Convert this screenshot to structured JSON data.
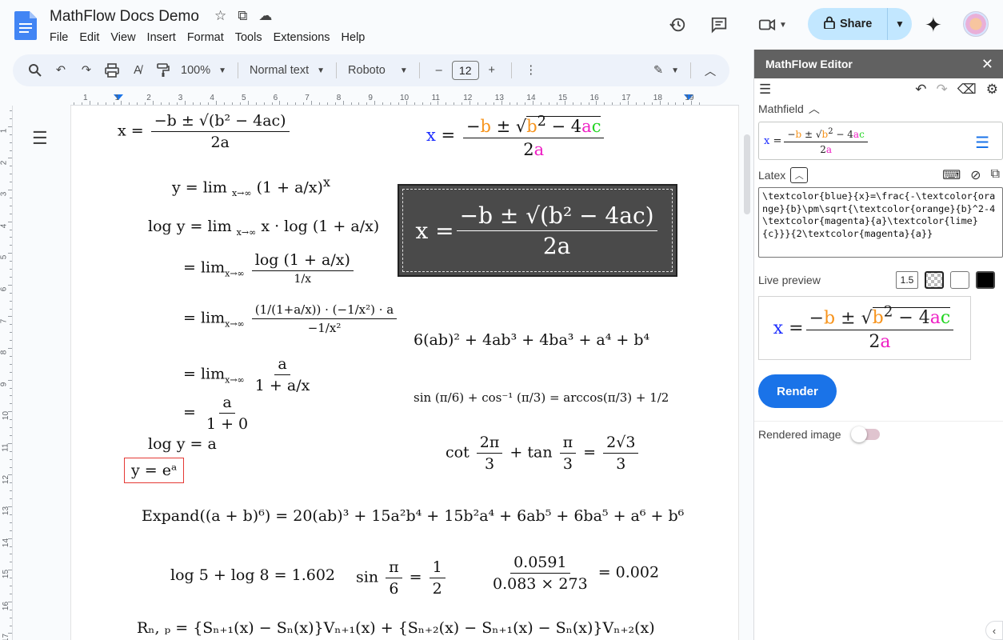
{
  "doc": {
    "title": "MathFlow Docs Demo",
    "menu": [
      "File",
      "Edit",
      "View",
      "Insert",
      "Format",
      "Tools",
      "Extensions",
      "Help"
    ]
  },
  "top_right": {
    "share_label": "Share",
    "icons": [
      "history-icon",
      "comment-icon",
      "meet-icon",
      "gemini-icon",
      "avatar"
    ]
  },
  "toolbar": {
    "zoom": "100%",
    "style": "Normal text",
    "font": "Roboto",
    "font_size": "12",
    "minus": "–",
    "plus": "+"
  },
  "ruler": {
    "numbers": [
      "1",
      "1",
      "2",
      "3",
      "4",
      "5",
      "6",
      "7",
      "8",
      "9",
      "10",
      "11",
      "12",
      "13",
      "14",
      "15",
      "16",
      "17",
      "18",
      "19"
    ],
    "vnumbers": [
      "1",
      "2",
      "3",
      "4",
      "5",
      "6",
      "7",
      "8",
      "9",
      "10",
      "11",
      "12",
      "13",
      "14",
      "15",
      "16",
      "17"
    ]
  },
  "document": {
    "formulas": {
      "quad_a_lhs": "x =",
      "quad_num": "−b ± √(b² − 4ac)",
      "quad_den": "2a",
      "lim1_lhs": "y = lim",
      "lim1_sub": "x→∞",
      "lim1_body": "(1 + a/x)",
      "lim1_exp": "x",
      "log_lhs": "log y = lim",
      "log_body": "x · log (1 + a/x)",
      "step3_num": "log (1 + a/x)",
      "step3_den": "1/x",
      "step4_num": "(1/(1+a/x)) · (−1/x²) · a",
      "step4_den": "−1/x²",
      "step5_num": "a",
      "step5_den": "1 + a/x",
      "step6_num": "a",
      "step6_den": "1 + 0",
      "eq": "=",
      "lim": "lim",
      "limsub": "x→∞",
      "log_y_a": "log y = a",
      "y_ea": "y = eᵃ",
      "poly": "6(ab)² + 4ab³ + 4ba³ + a⁴ + b⁴",
      "trig1": "sin (π/6) + cos⁻¹ (π/3) = arccos(π/3) + 1/2",
      "trig2_lhs": "cot",
      "trig2_frac1_num": "2π",
      "trig2_frac1_den": "3",
      "trig2_mid": "+ tan",
      "trig2_frac2_num": "π",
      "trig2_frac2_den": "3",
      "trig2_eq": "=",
      "trig2_rhs_num": "2√3",
      "trig2_rhs_den": "3",
      "expand": "Expand((a + b)⁶) = 20(ab)³ + 15a²b⁴ + 15b²a⁴ + 6ab⁵ + 6ba⁵ + a⁶ + b⁶",
      "log58": "log 5 + log 8 = 1.602",
      "sin_lhs": "sin",
      "sin_num": "π",
      "sin_den": "6",
      "sin_eq": "=",
      "sin_rhs_num": "1",
      "sin_rhs_den": "2",
      "ratio_num": "0.0591",
      "ratio_den": "0.083 × 273",
      "ratio_rhs": "= 0.002",
      "rnp": "Rₙ, ₚ = {Sₙ₊₁(x) − Sₙ(x)}Vₙ₊₁(x) + {Sₙ₊₂(x) − Sₙ₊₁(x) − Sₙ(x)}Vₙ₊₂(x)"
    },
    "colored_eq": {
      "x": "x",
      "eq": "=",
      "minus": "−",
      "b": "b",
      "pm": "±",
      "b2": "b",
      "sq": "2",
      "minus4": "− 4",
      "a": "a",
      "c": "c",
      "two": "2",
      "a2": "a"
    }
  },
  "panel": {
    "title": "MathFlow Editor",
    "mathfield_label": "Mathfield",
    "latex_label": "Latex",
    "latex_value": "\\textcolor{blue}{x}=\\frac{-\\textcolor{orange}{b}\\pm\\sqrt{\\textcolor{orange}{b}^2-4\\textcolor{magenta}{a}\\textcolor{lime}{c}}}{2\\textcolor{magenta}{a}}",
    "live_preview_label": "Live preview",
    "zoom_value": "1.5",
    "render_label": "Render",
    "rendered_image_label": "Rendered image"
  },
  "colors": {
    "accent": "#1a73e8",
    "share_bg": "#c2e7ff",
    "panel_header": "#616161",
    "blue": "#1e2fff",
    "orange": "#f7941d",
    "magenta": "#ee1ec4",
    "lime": "#22d422"
  }
}
